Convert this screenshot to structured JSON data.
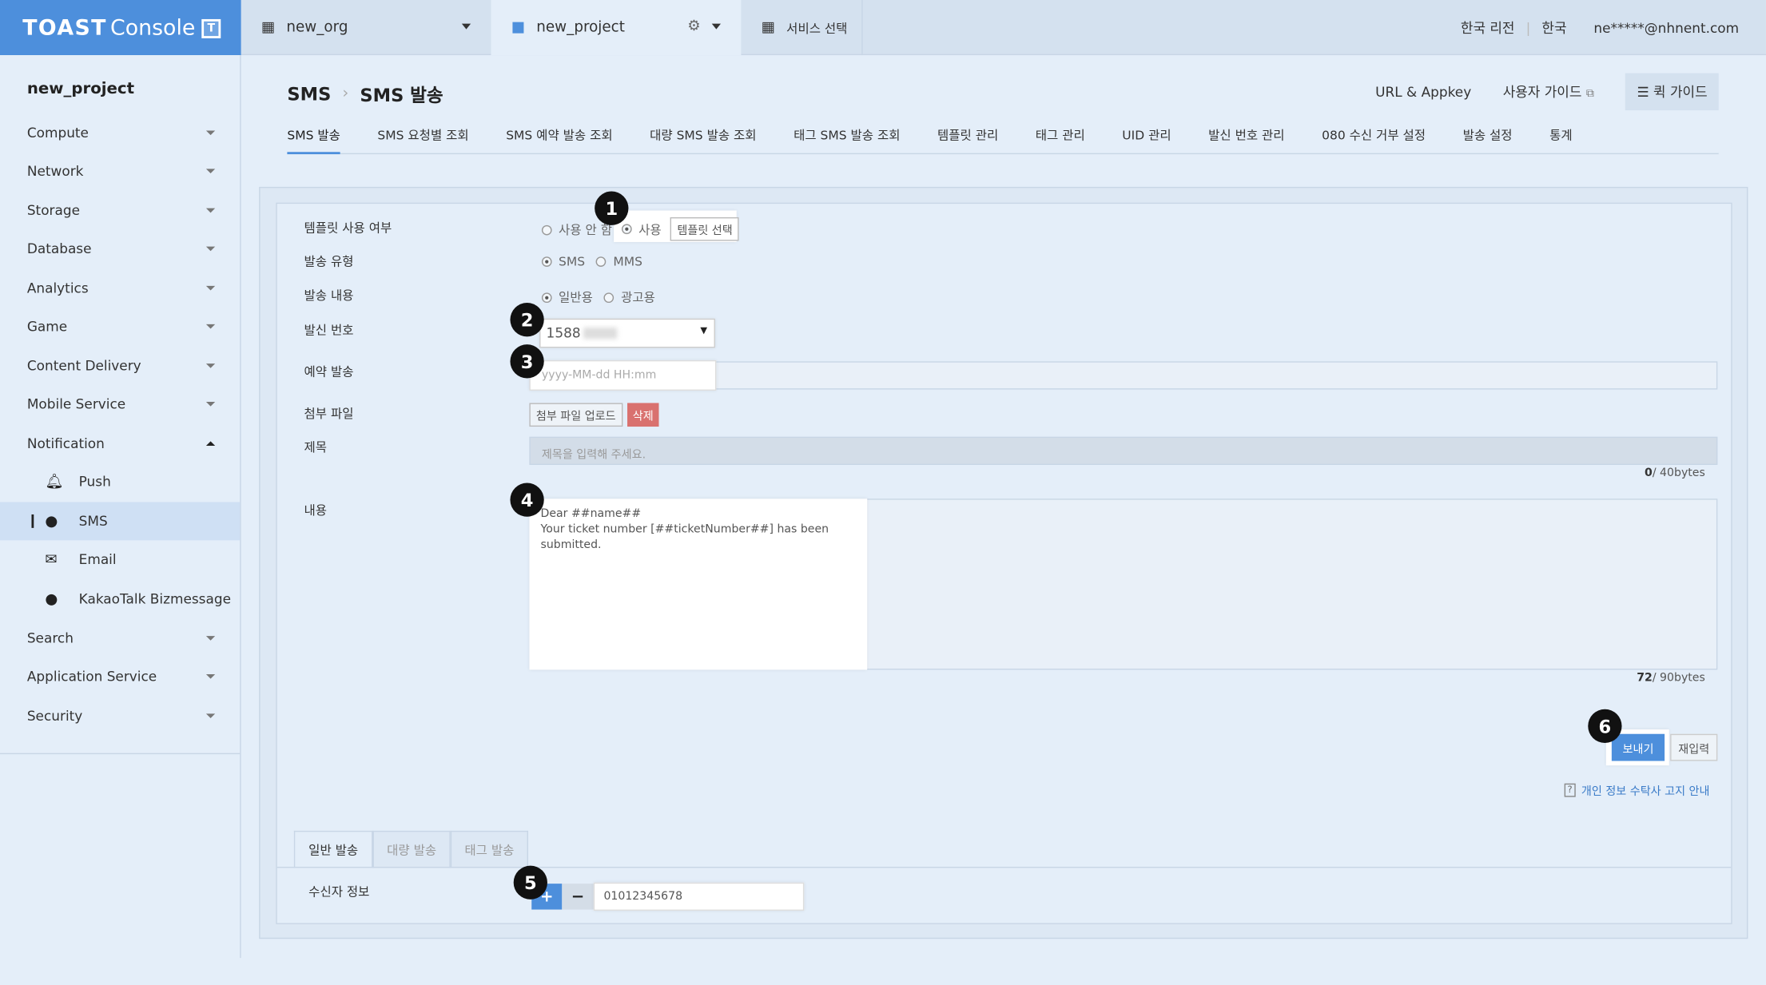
{
  "topbar": {
    "logo_brand": "TOAST",
    "logo_product": "Console",
    "logo_badge": "T",
    "org": "new_org",
    "project": "new_project",
    "service_select": "서비스 선택",
    "region": "한국 리전",
    "language": "한국",
    "user": "ne*****@nhnent.com"
  },
  "sidebar": {
    "title": "new_project",
    "items": [
      {
        "label": "Compute"
      },
      {
        "label": "Network"
      },
      {
        "label": "Storage"
      },
      {
        "label": "Database"
      },
      {
        "label": "Analytics"
      },
      {
        "label": "Game"
      },
      {
        "label": "Content Delivery"
      },
      {
        "label": "Mobile Service"
      },
      {
        "label": "Notification"
      },
      {
        "label": "Search"
      },
      {
        "label": "Application Service"
      },
      {
        "label": "Security"
      }
    ],
    "notification_sub": [
      {
        "label": "Push",
        "icon": "bell-icon"
      },
      {
        "label": "SMS",
        "icon": "sms-icon"
      },
      {
        "label": "Email",
        "icon": "envelope-icon"
      },
      {
        "label": "KakaoTalk Bizmessage",
        "icon": "chat-bubble-icon"
      }
    ]
  },
  "header": {
    "crumb_service": "SMS",
    "crumb_page": "SMS 발송",
    "url_appkey": "URL & Appkey",
    "user_guide": "사용자 가이드",
    "quick_guide": "퀵 가이드"
  },
  "tabs": [
    "SMS 발송",
    "SMS 요청별 조회",
    "SMS 예약 발송 조회",
    "대량 SMS 발송 조회",
    "태그 SMS 발송 조회",
    "템플릿 관리",
    "태그 관리",
    "UID 관리",
    "발신 번호 관리",
    "080 수신 거부 설정",
    "발송 설정",
    "통계"
  ],
  "form": {
    "template_label": "템플릿 사용 여부",
    "template_no": "사용 안 함",
    "template_yes": "사용",
    "template_select_btn": "템플릿 선택",
    "send_type_label": "발송 유형",
    "send_type_sms": "SMS",
    "send_type_mms": "MMS",
    "content_type_label": "발송 내용",
    "content_normal": "일반용",
    "content_ad": "광고용",
    "sender_label": "발신 번호",
    "sender_value": "1588",
    "reserve_label": "예약 발송",
    "reserve_placeholder": "yyyy-MM-dd HH:mm",
    "attach_label": "첨부 파일",
    "attach_upload": "첨부 파일 업로드",
    "attach_delete": "삭제",
    "title_label": "제목",
    "title_placeholder": "제목을 입력해 주세요.",
    "title_bytes_current": "0",
    "title_bytes_rest": "/ 40bytes",
    "body_label": "내용",
    "body_line1": "Dear ##name##",
    "body_line2": "Your ticket number [##ticketNumber##] has been submitted.",
    "body_bytes_current": "72",
    "body_bytes_rest": "/ 90bytes",
    "send_btn": "보내기",
    "reset_btn": "재입력",
    "privacy_link": "개인 정보 수탁사 고지 안내"
  },
  "recipient": {
    "tabs": [
      "일반 발송",
      "대량 발송",
      "태그 발송"
    ],
    "label": "수신자 정보",
    "add": "+",
    "remove": "−",
    "value": "01012345678"
  },
  "markers": [
    "1",
    "2",
    "3",
    "4",
    "5",
    "6"
  ],
  "colors": {
    "accent": "#4d8fdc",
    "danger": "#d9716f",
    "marker": "#111111"
  }
}
